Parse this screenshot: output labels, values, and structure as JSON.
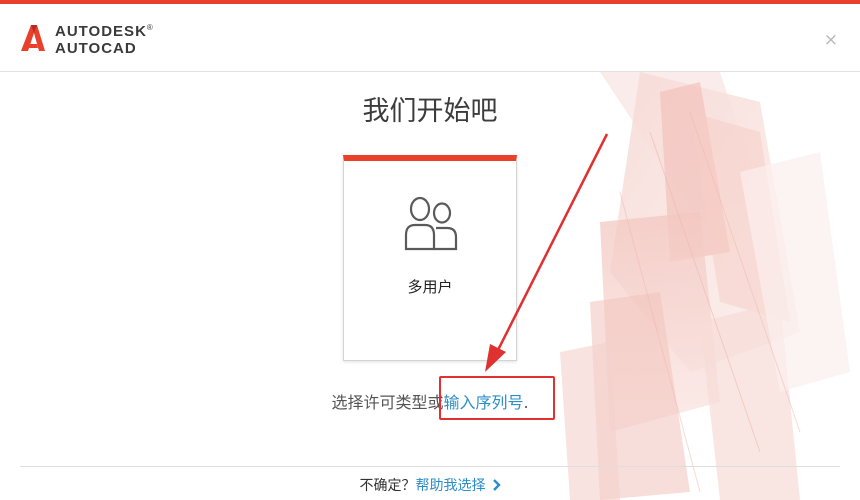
{
  "brand": {
    "line1": "AUTODESK",
    "line2": "AUTOCAD",
    "registered": "®",
    "accent_color": "#e8402b"
  },
  "window": {
    "close_glyph": "×"
  },
  "main": {
    "title": "我们开始吧",
    "card": {
      "label": "多用户",
      "icon": "users-icon"
    },
    "choose_prefix": "选择许可类型或",
    "serial_link": "输入序列号",
    "choose_suffix": "."
  },
  "footer": {
    "unsure_text": "不确定？",
    "help_link": "帮助我选择",
    "chevron_icon": "chevron-right-icon"
  },
  "annotation": {
    "color": "#e03030"
  },
  "colors": {
    "link": "#2b8ec9",
    "title_text": "#3c3c3c"
  }
}
